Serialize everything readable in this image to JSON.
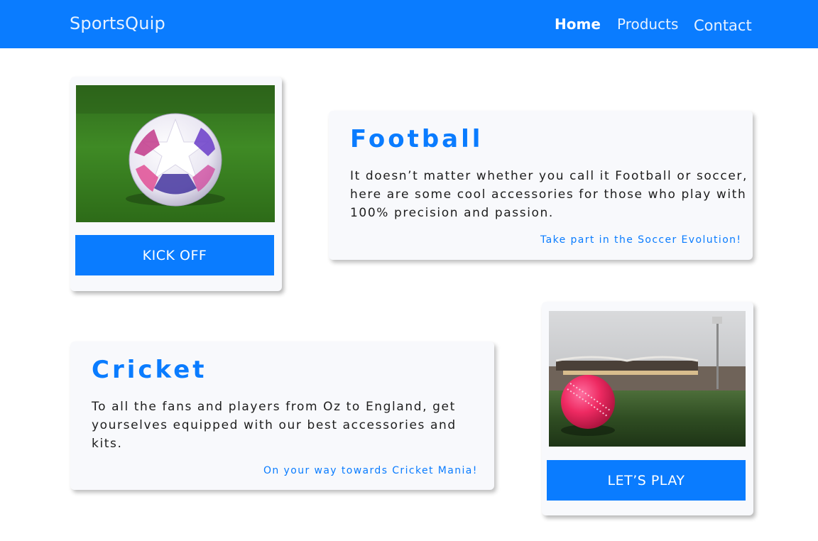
{
  "navbar": {
    "brand": "SportsQuip",
    "links": [
      {
        "label": "Home"
      },
      {
        "label": "Products"
      },
      {
        "label": "Contact"
      }
    ]
  },
  "football": {
    "image_alt": "Champions League football on grass",
    "button_label": "KICK OFF",
    "title": "Football",
    "body": "It doesn’t matter whether you call it Football or soccer, here are some cool accessories for those who play with 100% precision and passion.",
    "tagline": "Take part in the Soccer Evolution!"
  },
  "cricket": {
    "image_alt": "Pink cricket ball on grass in a stadium",
    "button_label": "LET’S PLAY",
    "title": "Cricket",
    "body": "To all the fans and players from Oz to England, get yourselves equipped with our best accessories and kits.",
    "tagline": "On your way towards Cricket Mania!"
  },
  "colors": {
    "brand_blue": "#0a7cff",
    "card_bg": "#f8f9fc"
  }
}
